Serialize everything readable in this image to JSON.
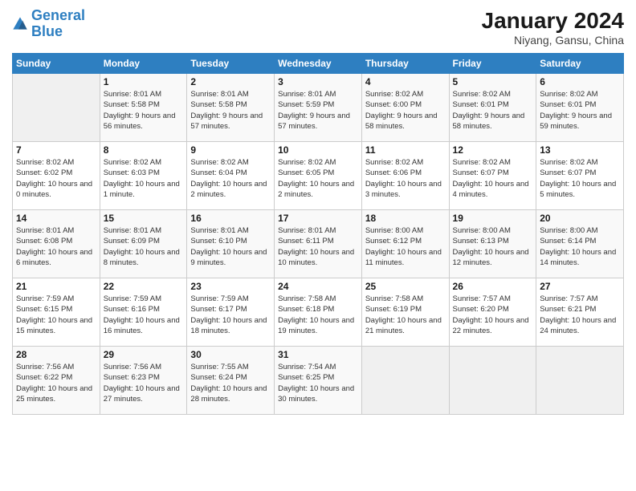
{
  "header": {
    "logo_line1": "General",
    "logo_line2": "Blue",
    "title": "January 2024",
    "subtitle": "Niyang, Gansu, China"
  },
  "weekdays": [
    "Sunday",
    "Monday",
    "Tuesday",
    "Wednesday",
    "Thursday",
    "Friday",
    "Saturday"
  ],
  "weeks": [
    [
      {
        "day": "",
        "sunrise": "",
        "sunset": "",
        "daylight": ""
      },
      {
        "day": "1",
        "sunrise": "Sunrise: 8:01 AM",
        "sunset": "Sunset: 5:58 PM",
        "daylight": "Daylight: 9 hours and 56 minutes."
      },
      {
        "day": "2",
        "sunrise": "Sunrise: 8:01 AM",
        "sunset": "Sunset: 5:58 PM",
        "daylight": "Daylight: 9 hours and 57 minutes."
      },
      {
        "day": "3",
        "sunrise": "Sunrise: 8:01 AM",
        "sunset": "Sunset: 5:59 PM",
        "daylight": "Daylight: 9 hours and 57 minutes."
      },
      {
        "day": "4",
        "sunrise": "Sunrise: 8:02 AM",
        "sunset": "Sunset: 6:00 PM",
        "daylight": "Daylight: 9 hours and 58 minutes."
      },
      {
        "day": "5",
        "sunrise": "Sunrise: 8:02 AM",
        "sunset": "Sunset: 6:01 PM",
        "daylight": "Daylight: 9 hours and 58 minutes."
      },
      {
        "day": "6",
        "sunrise": "Sunrise: 8:02 AM",
        "sunset": "Sunset: 6:01 PM",
        "daylight": "Daylight: 9 hours and 59 minutes."
      }
    ],
    [
      {
        "day": "7",
        "sunrise": "Sunrise: 8:02 AM",
        "sunset": "Sunset: 6:02 PM",
        "daylight": "Daylight: 10 hours and 0 minutes."
      },
      {
        "day": "8",
        "sunrise": "Sunrise: 8:02 AM",
        "sunset": "Sunset: 6:03 PM",
        "daylight": "Daylight: 10 hours and 1 minute."
      },
      {
        "day": "9",
        "sunrise": "Sunrise: 8:02 AM",
        "sunset": "Sunset: 6:04 PM",
        "daylight": "Daylight: 10 hours and 2 minutes."
      },
      {
        "day": "10",
        "sunrise": "Sunrise: 8:02 AM",
        "sunset": "Sunset: 6:05 PM",
        "daylight": "Daylight: 10 hours and 2 minutes."
      },
      {
        "day": "11",
        "sunrise": "Sunrise: 8:02 AM",
        "sunset": "Sunset: 6:06 PM",
        "daylight": "Daylight: 10 hours and 3 minutes."
      },
      {
        "day": "12",
        "sunrise": "Sunrise: 8:02 AM",
        "sunset": "Sunset: 6:07 PM",
        "daylight": "Daylight: 10 hours and 4 minutes."
      },
      {
        "day": "13",
        "sunrise": "Sunrise: 8:02 AM",
        "sunset": "Sunset: 6:07 PM",
        "daylight": "Daylight: 10 hours and 5 minutes."
      }
    ],
    [
      {
        "day": "14",
        "sunrise": "Sunrise: 8:01 AM",
        "sunset": "Sunset: 6:08 PM",
        "daylight": "Daylight: 10 hours and 6 minutes."
      },
      {
        "day": "15",
        "sunrise": "Sunrise: 8:01 AM",
        "sunset": "Sunset: 6:09 PM",
        "daylight": "Daylight: 10 hours and 8 minutes."
      },
      {
        "day": "16",
        "sunrise": "Sunrise: 8:01 AM",
        "sunset": "Sunset: 6:10 PM",
        "daylight": "Daylight: 10 hours and 9 minutes."
      },
      {
        "day": "17",
        "sunrise": "Sunrise: 8:01 AM",
        "sunset": "Sunset: 6:11 PM",
        "daylight": "Daylight: 10 hours and 10 minutes."
      },
      {
        "day": "18",
        "sunrise": "Sunrise: 8:00 AM",
        "sunset": "Sunset: 6:12 PM",
        "daylight": "Daylight: 10 hours and 11 minutes."
      },
      {
        "day": "19",
        "sunrise": "Sunrise: 8:00 AM",
        "sunset": "Sunset: 6:13 PM",
        "daylight": "Daylight: 10 hours and 12 minutes."
      },
      {
        "day": "20",
        "sunrise": "Sunrise: 8:00 AM",
        "sunset": "Sunset: 6:14 PM",
        "daylight": "Daylight: 10 hours and 14 minutes."
      }
    ],
    [
      {
        "day": "21",
        "sunrise": "Sunrise: 7:59 AM",
        "sunset": "Sunset: 6:15 PM",
        "daylight": "Daylight: 10 hours and 15 minutes."
      },
      {
        "day": "22",
        "sunrise": "Sunrise: 7:59 AM",
        "sunset": "Sunset: 6:16 PM",
        "daylight": "Daylight: 10 hours and 16 minutes."
      },
      {
        "day": "23",
        "sunrise": "Sunrise: 7:59 AM",
        "sunset": "Sunset: 6:17 PM",
        "daylight": "Daylight: 10 hours and 18 minutes."
      },
      {
        "day": "24",
        "sunrise": "Sunrise: 7:58 AM",
        "sunset": "Sunset: 6:18 PM",
        "daylight": "Daylight: 10 hours and 19 minutes."
      },
      {
        "day": "25",
        "sunrise": "Sunrise: 7:58 AM",
        "sunset": "Sunset: 6:19 PM",
        "daylight": "Daylight: 10 hours and 21 minutes."
      },
      {
        "day": "26",
        "sunrise": "Sunrise: 7:57 AM",
        "sunset": "Sunset: 6:20 PM",
        "daylight": "Daylight: 10 hours and 22 minutes."
      },
      {
        "day": "27",
        "sunrise": "Sunrise: 7:57 AM",
        "sunset": "Sunset: 6:21 PM",
        "daylight": "Daylight: 10 hours and 24 minutes."
      }
    ],
    [
      {
        "day": "28",
        "sunrise": "Sunrise: 7:56 AM",
        "sunset": "Sunset: 6:22 PM",
        "daylight": "Daylight: 10 hours and 25 minutes."
      },
      {
        "day": "29",
        "sunrise": "Sunrise: 7:56 AM",
        "sunset": "Sunset: 6:23 PM",
        "daylight": "Daylight: 10 hours and 27 minutes."
      },
      {
        "day": "30",
        "sunrise": "Sunrise: 7:55 AM",
        "sunset": "Sunset: 6:24 PM",
        "daylight": "Daylight: 10 hours and 28 minutes."
      },
      {
        "day": "31",
        "sunrise": "Sunrise: 7:54 AM",
        "sunset": "Sunset: 6:25 PM",
        "daylight": "Daylight: 10 hours and 30 minutes."
      },
      {
        "day": "",
        "sunrise": "",
        "sunset": "",
        "daylight": ""
      },
      {
        "day": "",
        "sunrise": "",
        "sunset": "",
        "daylight": ""
      },
      {
        "day": "",
        "sunrise": "",
        "sunset": "",
        "daylight": ""
      }
    ]
  ]
}
